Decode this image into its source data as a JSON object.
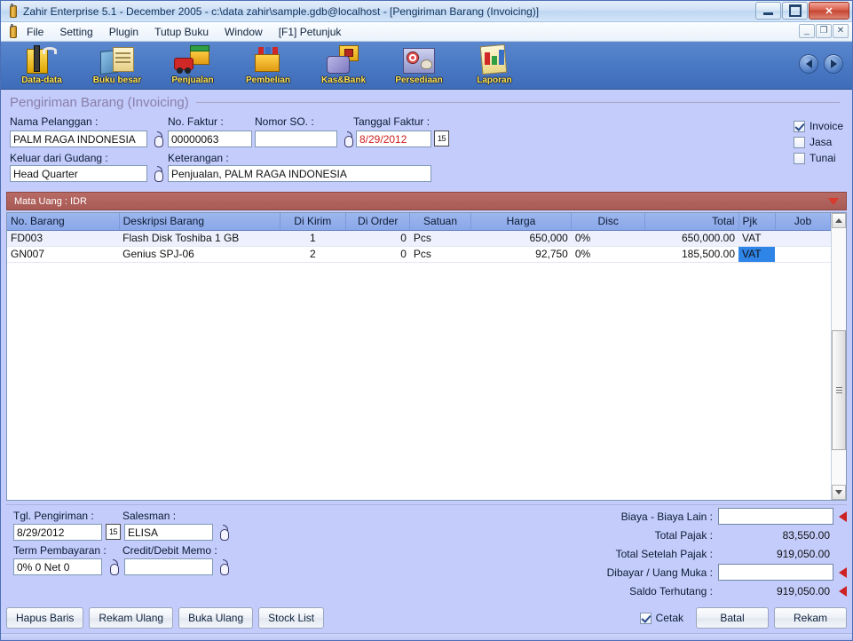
{
  "window": {
    "title": "Zahir Enterprise 5.1 - December 2005 - c:\\data zahir\\sample.gdb@localhost - [Pengiriman Barang (Invoicing)]",
    "minimize": "–",
    "maximize": "□",
    "close": "✕",
    "mdi_minimize": "_",
    "mdi_restore": "❐",
    "mdi_close": "✕"
  },
  "menu": {
    "items": [
      {
        "label": "File"
      },
      {
        "label": "Setting"
      },
      {
        "label": "Plugin"
      },
      {
        "label": "Tutup Buku"
      },
      {
        "label": "Window"
      },
      {
        "label": "[F1] Petunjuk"
      }
    ]
  },
  "toolbar": {
    "items": [
      {
        "label": "Data-data",
        "icon": "data-folder-icon"
      },
      {
        "label": "Buku besar",
        "icon": "ledger-book-icon"
      },
      {
        "label": "Penjualan",
        "icon": "sales-truck-gift-icon"
      },
      {
        "label": "Pembelian",
        "icon": "purchase-gift-icon"
      },
      {
        "label": "Kas&Bank",
        "icon": "cash-bank-icon"
      },
      {
        "label": "Persediaan",
        "icon": "inventory-warehouse-icon"
      },
      {
        "label": "Laporan",
        "icon": "report-chart-icon"
      }
    ],
    "nav_prev": "prev-record-button",
    "nav_next": "next-record-button"
  },
  "form": {
    "section_title": "Pengiriman Barang (Invoicing)",
    "fields": {
      "nama_pelanggan_label": "Nama Pelanggan :",
      "nama_pelanggan_value": "PALM RAGA INDONESIA",
      "no_faktur_label": "No. Faktur :",
      "no_faktur_value": "00000063",
      "nomor_so_label": "Nomor SO. :",
      "nomor_so_value": "",
      "tanggal_faktur_label": "Tanggal Faktur :",
      "tanggal_faktur_value": "8/29/2012",
      "calendar_btn": "15",
      "keluar_dari_gudang_label": "Keluar dari Gudang :",
      "keluar_dari_gudang_value": "Head Quarter",
      "keterangan_label": "Keterangan :",
      "keterangan_value": "Penjualan, PALM RAGA INDONESIA"
    },
    "checkboxes": [
      {
        "label": "Invoice",
        "checked": true
      },
      {
        "label": "Jasa",
        "checked": false
      },
      {
        "label": "Tunai",
        "checked": false
      }
    ]
  },
  "currency_bar": {
    "label": "Mata Uang : IDR"
  },
  "grid": {
    "columns": [
      {
        "label": "No. Barang",
        "align": "left"
      },
      {
        "label": "Deskripsi Barang",
        "align": "left"
      },
      {
        "label": "Di Kirim",
        "align": "center"
      },
      {
        "label": "Di Order",
        "align": "center"
      },
      {
        "label": "Satuan",
        "align": "center"
      },
      {
        "label": "Harga",
        "align": "center"
      },
      {
        "label": "Disc",
        "align": "center"
      },
      {
        "label": "Total",
        "align": "right"
      },
      {
        "label": "Pjk",
        "align": "left"
      },
      {
        "label": "Job",
        "align": "center"
      }
    ],
    "rows": [
      {
        "no_barang": "FD003",
        "deskripsi": "Flash Disk Toshiba 1 GB",
        "di_kirim": "1",
        "di_order": "0",
        "satuan": "Pcs",
        "harga": "650,000",
        "disc": "0%",
        "total": "650,000.00",
        "pjk": "VAT",
        "job": "",
        "pjk_selected": false
      },
      {
        "no_barang": "GN007",
        "deskripsi": "Genius SPJ-06",
        "di_kirim": "2",
        "di_order": "0",
        "satuan": "Pcs",
        "harga": "92,750",
        "disc": "0%",
        "total": "185,500.00",
        "pjk": "VAT",
        "job": "",
        "pjk_selected": true
      }
    ]
  },
  "footer": {
    "tgl_pengiriman_label": "Tgl. Pengiriman :",
    "tgl_pengiriman_value": "8/29/2012",
    "tgl_calendar_btn": "15",
    "salesman_label": "Salesman :",
    "salesman_value": "ELISA",
    "term_pembayaran_label": "Term Pembayaran :",
    "term_pembayaran_value": "0% 0 Net 0",
    "credit_debit_memo_label": "Credit/Debit Memo :",
    "credit_debit_memo_value": ""
  },
  "totals": [
    {
      "label": "Biaya - Biaya Lain :",
      "value": "",
      "input": true,
      "arrow": true
    },
    {
      "label": "Total Pajak :",
      "value": "83,550.00",
      "input": false,
      "arrow": false
    },
    {
      "label": "Total Setelah Pajak :",
      "value": "919,050.00",
      "input": false,
      "arrow": false
    },
    {
      "label": "Dibayar / Uang Muka :",
      "value": "",
      "input": true,
      "arrow": true
    },
    {
      "label": "Saldo Terhutang :",
      "value": "919,050.00",
      "input": false,
      "arrow": true
    }
  ],
  "buttons": {
    "hapus_baris": "Hapus Baris",
    "rekam_ulang": "Rekam Ulang",
    "buka_ulang": "Buka Ulang",
    "stock_list": "Stock List",
    "cetak_label": "Cetak",
    "cetak_checked": true,
    "batal": "Batal",
    "rekam": "Rekam"
  },
  "colors": {
    "window_bg": "#c3ccfb",
    "toolbar_blue": "#4a79c4",
    "currency_bar": "#b06058",
    "grid_header": "#93ace9",
    "selection": "#2f84e8",
    "accent_red": "#d02020"
  }
}
